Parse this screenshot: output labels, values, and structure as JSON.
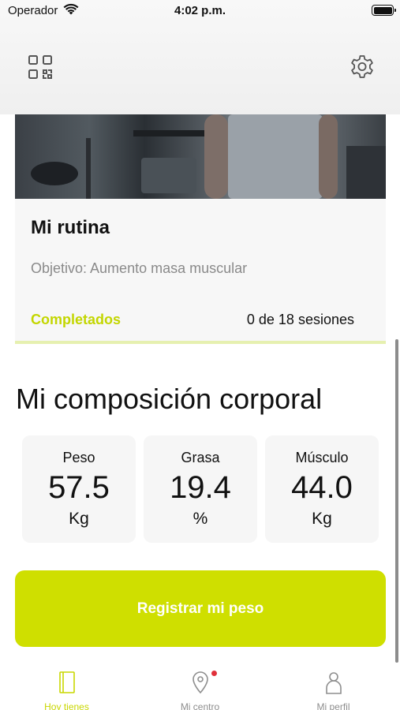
{
  "status_bar": {
    "carrier": "Operador",
    "time": "4:02 p.m."
  },
  "top_bar": {
    "left_icon": "qr-code-icon",
    "right_icon": "gear-icon"
  },
  "routine_card": {
    "title": "Mi rutina",
    "goal": "Objetivo: Aumento masa muscular",
    "completed_label": "Completados",
    "sessions": "0 de 18 sesiones",
    "progress_fraction": 0
  },
  "composition": {
    "title": "Mi composición corporal",
    "metrics": [
      {
        "label": "Peso",
        "value": "57.5",
        "unit": "Kg"
      },
      {
        "label": "Grasa",
        "value": "19.4",
        "unit": "%"
      },
      {
        "label": "Músculo",
        "value": "44.0",
        "unit": "Kg"
      }
    ]
  },
  "register_button": {
    "label": "Registrar mi peso"
  },
  "tab_bar": {
    "tabs": [
      {
        "label": "Hoy tienes",
        "icon": "book-icon",
        "active": true
      },
      {
        "label": "Mi centro",
        "icon": "location-pin-icon",
        "active": false,
        "badge": true
      },
      {
        "label": "Mi perfil",
        "icon": "person-icon",
        "active": false
      }
    ]
  },
  "colors": {
    "accent": "#cfdf00",
    "accent_text": "#c3d600",
    "badge": "#e0303a"
  }
}
